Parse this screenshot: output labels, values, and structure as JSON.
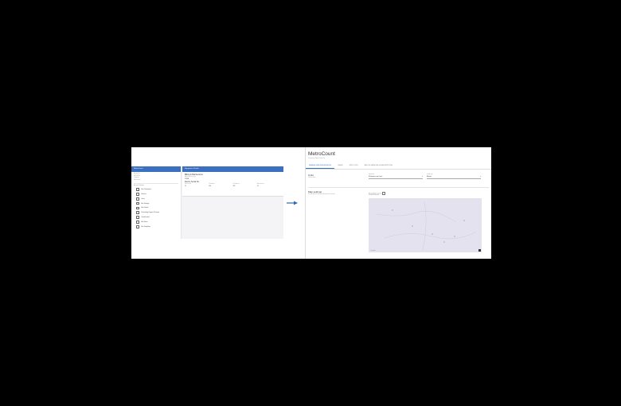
{
  "left_screen": {
    "sidebar": {
      "header": "MetroCount",
      "meta": [
        "Account ID",
        "MC001234",
        "Company",
        "MetroCount"
      ],
      "section": "Account Settings",
      "items": [
        {
          "icon": "square-icon",
          "label": "Site Parameters"
        },
        {
          "icon": "square-icon",
          "label": "Sensors"
        },
        {
          "icon": "square-icon",
          "label": "Users"
        },
        {
          "icon": "square-icon",
          "label": "Site Settings"
        },
        {
          "icon": "square-icon",
          "label": "Site Details"
        },
        {
          "icon": "square-icon",
          "label": "Scheduling Region & Format"
        },
        {
          "icon": "square-icon",
          "label": "Classification"
        },
        {
          "icon": "square-icon",
          "label": "Site Notes"
        },
        {
          "icon": "square-icon",
          "label": "Site Templates"
        }
      ]
    },
    "detail": {
      "header": "Equipment Details",
      "title": "Billing & Maintenance",
      "sub": "Billing account type",
      "value": "ZONE",
      "section2": "Device Serial No.",
      "grid": [
        {
          "label": "Service ends",
          "value": "12"
        },
        {
          "label": "Sub devices",
          "value": "140"
        },
        {
          "label": "Total devices",
          "value": "162"
        },
        {
          "label": "Active devices",
          "value": "12"
        }
      ]
    }
  },
  "right_screen": {
    "title": "MetroCount",
    "subtitle": "Company: MetroCount Pty",
    "tabs": [
      {
        "label": "MANAGE DATA PREFERENCES",
        "active": true
      },
      {
        "label": "USERS",
        "active": false
      },
      {
        "label": "SITE TOOLS",
        "active": false
      },
      {
        "label": "ADD ON SERVICES & SUBSCRIPTIONS",
        "active": false
      }
    ],
    "units": {
      "title": "Units",
      "sub": "Default units",
      "field1_label": "Speed unit",
      "field1_value": "Kilometres per hour",
      "field2_label": "Length unit",
      "field2_value": "Metres"
    },
    "map_settings": {
      "title": "Map settings",
      "sub": "Set the default map area shown for new sites",
      "checkbox_label": "Show default map area",
      "map_sub": "Set default map area",
      "logo": "©mapbox"
    }
  }
}
